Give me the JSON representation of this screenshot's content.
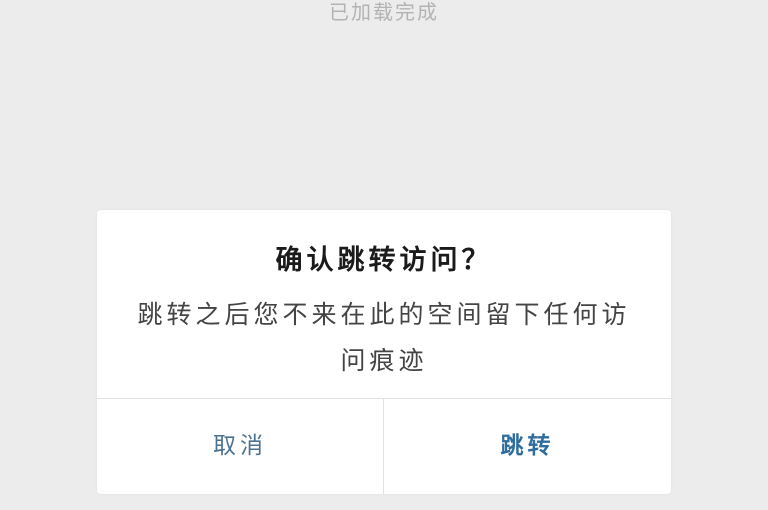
{
  "background": {
    "caption": "已加载完成"
  },
  "dialog": {
    "title": "确认跳转访问？",
    "message": "跳转之后您不来在此的空间留下任何访问痕迹",
    "cancel_label": "取消",
    "confirm_label": "跳转"
  },
  "colors": {
    "page_background": "#ececec",
    "dialog_background": "#ffffff",
    "button_text": "#2f6d9e"
  }
}
